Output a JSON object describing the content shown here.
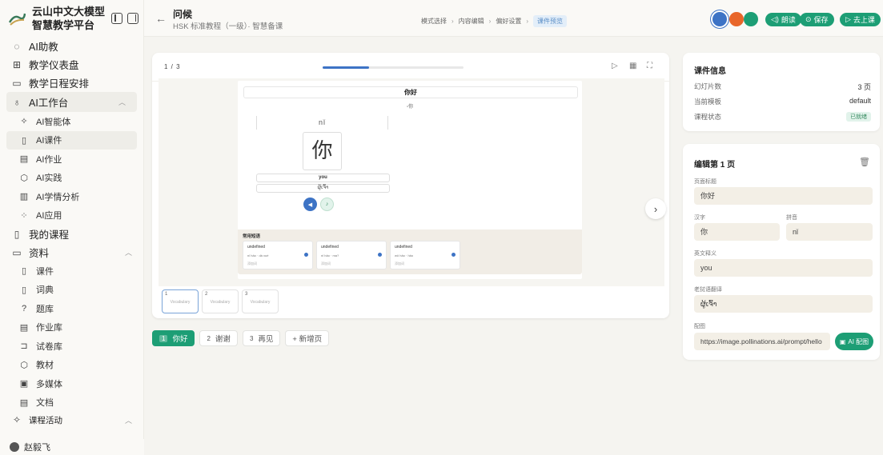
{
  "brand": {
    "line1": "云山中文大模型",
    "line2": "智慧教学平台"
  },
  "sidebar": {
    "items": [
      {
        "label": "AI助教",
        "icon": "chat-bubble-icon"
      },
      {
        "label": "教学仪表盘",
        "icon": "dashboard-icon"
      },
      {
        "label": "教学日程安排",
        "icon": "calendar-icon"
      },
      {
        "label": "AI工作台",
        "icon": "bulb-icon"
      },
      {
        "label": "AI智能体",
        "icon": "sparkle-icon"
      },
      {
        "label": "AI课件",
        "icon": "book-icon"
      },
      {
        "label": "AI作业",
        "icon": "file-icon"
      },
      {
        "label": "AI实践",
        "icon": "hexagon-icon"
      },
      {
        "label": "AI学情分析",
        "icon": "bar-chart-icon"
      },
      {
        "label": "AI应用",
        "icon": "apps-icon"
      },
      {
        "label": "我的课程",
        "icon": "book-open-icon"
      },
      {
        "label": "资料",
        "icon": "folder-icon"
      },
      {
        "label": "课件",
        "icon": "book-icon"
      },
      {
        "label": "词典",
        "icon": "book-icon"
      },
      {
        "label": "题库",
        "icon": "question-icon"
      },
      {
        "label": "作业库",
        "icon": "file-icon"
      },
      {
        "label": "试卷库",
        "icon": "exam-icon"
      },
      {
        "label": "教材",
        "icon": "hexagon-icon"
      },
      {
        "label": "多媒体",
        "icon": "image-icon"
      },
      {
        "label": "文档",
        "icon": "file-icon"
      },
      {
        "label": "课程活动",
        "icon": "sparkle-icon"
      }
    ],
    "user": "赵毅飞"
  },
  "header": {
    "title": "问候",
    "subtitle": "HSK 标准教程（一级）· 智慧备课",
    "breadcrumb": [
      "模式选择",
      "内容编辑",
      "偏好设置",
      "课件预览"
    ],
    "theme_colors": [
      "#3d73c5",
      "#e8662a",
      "#1d9e75"
    ],
    "read_label": "朗读",
    "save_label": "保存",
    "class_label": "去上课"
  },
  "slide": {
    "counter": "1 / 3",
    "progress": 0.33,
    "title": "你好",
    "img_alt": "你",
    "pinyin": "nǐ",
    "hanzi": "你",
    "english": "you",
    "translation": "ຜູ້ເຈົ້າ",
    "phrase_title": "常用短语",
    "phrases": [
      {
        "title": "undefined",
        "pinyin": "nǐ hǎo · dà xué",
        "meta": "添加词"
      },
      {
        "title": "undefined",
        "pinyin": "nǐ hǎo · ma?",
        "meta": "添加词"
      },
      {
        "title": "undefined",
        "pinyin": "wǒ hǎo · hǎo",
        "meta": "添加词"
      }
    ],
    "thumbs": [
      {
        "num": "1",
        "label": "Vocabulary"
      },
      {
        "num": "2",
        "label": "Vocabulary"
      },
      {
        "num": "3",
        "label": "Vocabulary"
      }
    ]
  },
  "pages": [
    {
      "num": "1",
      "label": "你好"
    },
    {
      "num": "2",
      "label": "谢谢"
    },
    {
      "num": "3",
      "label": "再见"
    }
  ],
  "add_page_label": "+ 新增页",
  "info": {
    "title": "课件信息",
    "rows": [
      {
        "label": "幻灯片数",
        "value": "3 页"
      },
      {
        "label": "当前模板",
        "value": "default"
      },
      {
        "label": "课程状态",
        "value": "已就绪"
      }
    ]
  },
  "edit": {
    "title": "编辑第 1 页",
    "page_title_label": "页面标题",
    "page_title": "你好",
    "hanzi_label": "汉字",
    "hanzi": "你",
    "pinyin_label": "拼音",
    "pinyin": "nǐ",
    "english_label": "英文释义",
    "english": "you",
    "translation_label": "老挝语翻译",
    "translation": "ຜູ້ເຈົ້າ",
    "image_label": "配图",
    "image_url": "https://image.pollinations.ai/prompt/hello",
    "ai_image_label": "AI 配图"
  }
}
